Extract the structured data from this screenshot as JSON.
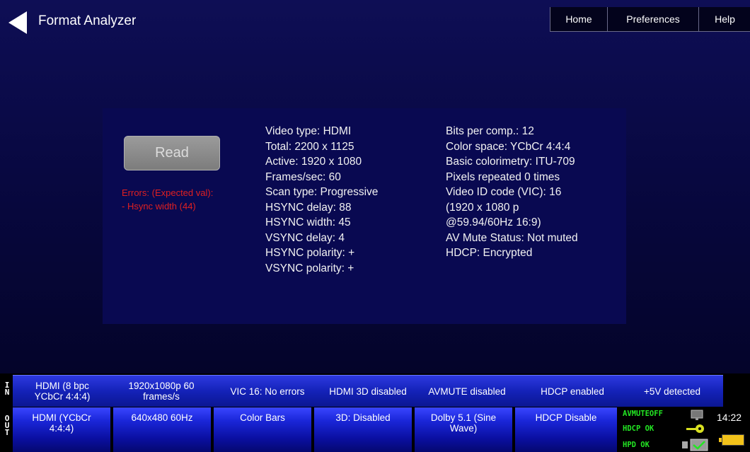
{
  "header": {
    "title": "Format Analyzer",
    "tabs": [
      "Home",
      "Preferences",
      "Help"
    ]
  },
  "read_button": "Read",
  "errors": {
    "title": "Errors: (Expected val):",
    "item": "- Hsync width (44)"
  },
  "info_left": [
    "Video type: HDMI",
    "Total: 2200 x 1125",
    "Active: 1920 x 1080",
    "Frames/sec: 60",
    "Scan type: Progressive",
    "HSYNC delay: 88",
    "HSYNC width: 45",
    "VSYNC delay: 4",
    "HSYNC polarity: +",
    "VSYNC polarity: +"
  ],
  "info_right": [
    "Bits per comp.: 12",
    "Color space: YCbCr 4:4:4",
    "Basic colorimetry: ITU-709",
    "Pixels repeated 0 times",
    "Video ID code (VIC): 16",
    "(1920 x 1080 p",
    "@59.94/60Hz 16:9)",
    "AV Mute Status: Not muted",
    "HDCP: Encrypted"
  ],
  "in_bar": {
    "label": "IN",
    "items": [
      [
        "HDMI (8 bpc",
        "YCbCr 4:4:4)"
      ],
      [
        "1920x1080p 60",
        "frames/s"
      ],
      [
        "VIC 16: No errors"
      ],
      [
        "HDMI 3D disabled"
      ],
      [
        "AVMUTE disabled"
      ],
      [
        "HDCP enabled"
      ],
      [
        "+5V detected"
      ]
    ]
  },
  "out_bar": {
    "label": "OUT",
    "items": [
      [
        "HDMI (YCbCr",
        "4:4:4)"
      ],
      [
        "640x480 60Hz"
      ],
      [
        "Color Bars"
      ],
      [
        "3D: Disabled"
      ],
      [
        "Dolby 5.1 (Sine",
        "Wave)"
      ],
      [
        "HDCP Disable"
      ]
    ]
  },
  "status": {
    "avmute": "AVMUTEOFF",
    "hdcp": "HDCP OK",
    "hpd": "HPD OK"
  },
  "clock": "14:22",
  "colors": {
    "error_text": "#e02020",
    "status_text": "#23e623",
    "bar_blue": "#1422b8"
  }
}
